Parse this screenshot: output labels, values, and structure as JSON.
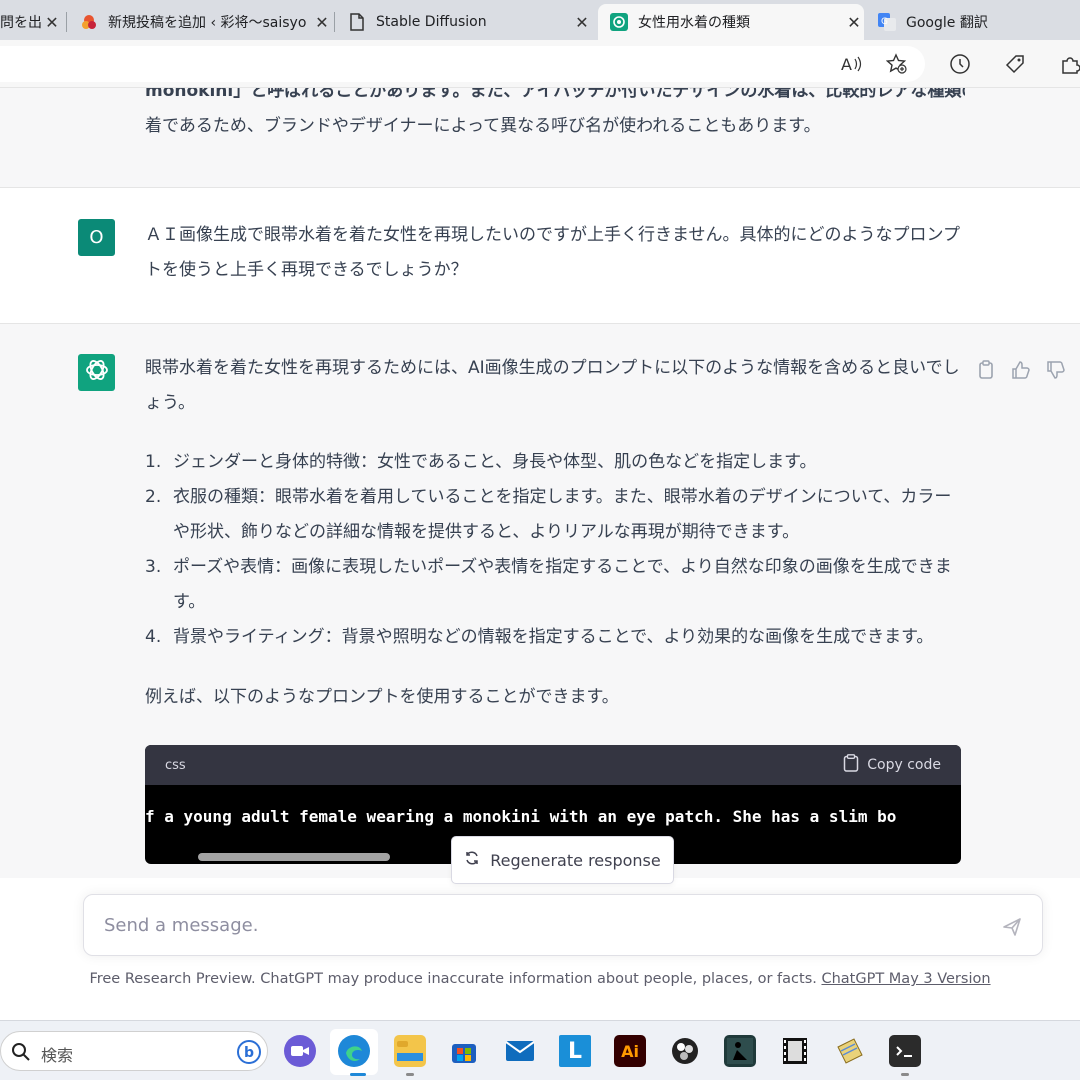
{
  "browser": {
    "tabs": [
      {
        "title": "問を出",
        "favicon": "page-icon"
      },
      {
        "title": "新規投稿を追加 ‹ 彩将〜saisyo",
        "favicon": "site-logo-icon"
      },
      {
        "title": "Stable Diffusion",
        "favicon": "document-icon"
      },
      {
        "title": "女性用水着の種類",
        "favicon": "chatgpt-icon"
      },
      {
        "title": "Google 翻訳",
        "favicon": "google-translate-icon"
      }
    ],
    "toolbar_icons": [
      "read-aloud-icon",
      "add-favorite-icon",
      "history-icon",
      "coupon-icon",
      "extensions-icon"
    ]
  },
  "chat": {
    "prev_assistant_lines": [
      "monokini」と呼ばれることがあります。また、アイパッチが付いたデザインの水着は、比較的レアな種類の水",
      "着であるため、ブランドやデザイナーによって異なる呼び名が使われることもあります。"
    ],
    "user_message": {
      "avatar": "O",
      "text": "ＡＩ画像生成で眼帯水着を着た女性を再現したいのですが上手く行きません。具体的にどのようなプロンプトを使うと上手く再現できるでしょうか？"
    },
    "assistant_message": {
      "intro": "眼帯水着を着た女性を再現するためには、AI画像生成のプロンプトに以下のような情報を含めると良いでしょう。",
      "list": [
        {
          "num": "1.",
          "text": "ジェンダーと身体的特徴：女性であること、身長や体型、肌の色などを指定します。"
        },
        {
          "num": "2.",
          "text": "衣服の種類：眼帯水着を着用していることを指定します。また、眼帯水着のデザインについて、カラーや形状、飾りなどの詳細な情報を提供すると、よりリアルな再現が期待できます。"
        },
        {
          "num": "3.",
          "text": "ポーズや表情：画像に表現したいポーズや表情を指定することで、より自然な印象の画像を生成できます。"
        },
        {
          "num": "4.",
          "text": "背景やライティング：背景や照明などの情報を指定することで、より効果的な画像を生成できます。"
        }
      ],
      "example_intro": "例えば、以下のようなプロンプトを使用することができます。",
      "code": {
        "language": "css",
        "copy_label": "Copy code",
        "line": "f a young adult female wearing a monokini with an eye patch. She has a slim bo"
      }
    },
    "regenerate_label": "Regenerate response",
    "input_placeholder": "Send a message.",
    "footer_text": "Free Research Preview. ChatGPT may produce inaccurate information about people, places, or facts. ",
    "footer_link": "ChatGPT May 3 Version"
  },
  "taskbar": {
    "search_placeholder": "検索",
    "apps": [
      {
        "name": "meet-icon"
      },
      {
        "name": "edge-icon"
      },
      {
        "name": "file-explorer-icon"
      },
      {
        "name": "store-icon"
      },
      {
        "name": "mail-icon"
      },
      {
        "name": "app-l-icon",
        "label": "L"
      },
      {
        "name": "illustrator-icon",
        "label": "Ai"
      },
      {
        "name": "obs-icon"
      },
      {
        "name": "reader-icon"
      },
      {
        "name": "film-icon"
      },
      {
        "name": "notes-icon"
      },
      {
        "name": "terminal-icon"
      }
    ]
  },
  "colors": {
    "chatgpt_green": "#10a37f",
    "user_avatar": "#0b8a77",
    "assistant_bg": "#f7f7f8",
    "code_bg": "#000000",
    "code_header": "#343541"
  }
}
